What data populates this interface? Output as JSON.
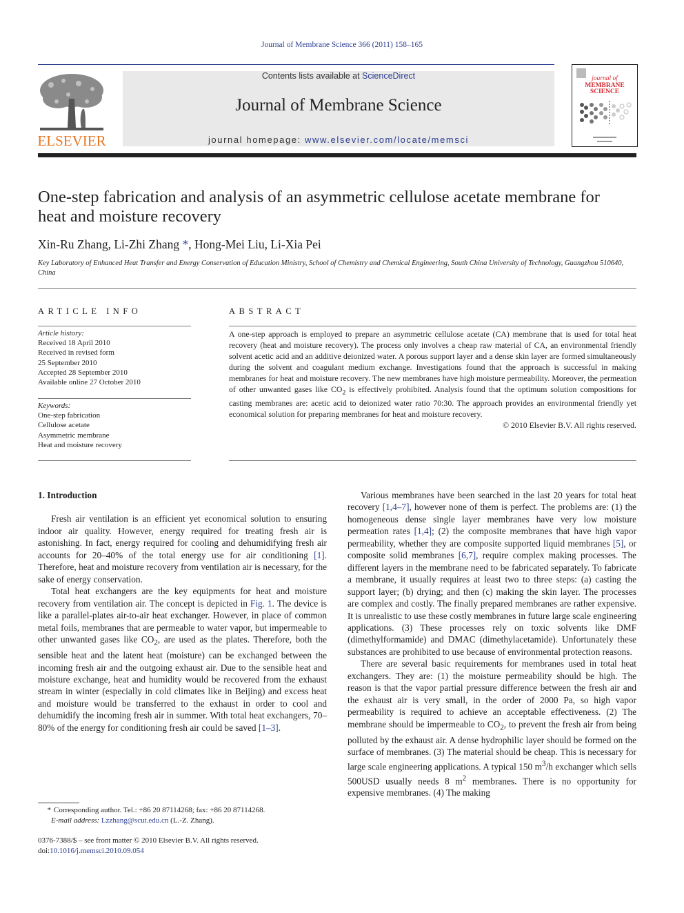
{
  "header": {
    "running_head": "Journal of Membrane Science 366 (2011) 158–165",
    "contents_prefix": "Contents lists available at ",
    "contents_link": "ScienceDirect",
    "journal_name": "Journal of Membrane Science",
    "homepage_prefix": "journal homepage: ",
    "homepage_link": "www.elsevier.com/locate/memsci",
    "publisher_logo": "ELSEVIER",
    "cover_title_line1": "journal of",
    "cover_title_line2": "MEMBRANE",
    "cover_title_line3": "SCIENCE"
  },
  "article": {
    "title": "One-step fabrication and analysis of an asymmetric cellulose acetate membrane for heat and moisture recovery",
    "authors_before": "Xin-Ru Zhang, Li-Zhi Zhang",
    "corresponding_mark": "*",
    "authors_after": ", Hong-Mei Liu, Li-Xia Pei",
    "affiliation": "Key Laboratory of Enhanced Heat Transfer and Energy Conservation of Education Ministry, School of Chemistry and Chemical Engineering, South China University of Technology, Guangzhou 510640, China"
  },
  "article_info": {
    "heading": "ARTICLE INFO",
    "history_label": "Article history:",
    "history": [
      "Received 18 April 2010",
      "Received in revised form",
      "25 September 2010",
      "Accepted 28 September 2010",
      "Available online 27 October 2010"
    ],
    "keywords_label": "Keywords:",
    "keywords": [
      "One-step fabrication",
      "Cellulose acetate",
      "Asymmetric membrane",
      "Heat and moisture recovery"
    ]
  },
  "abstract": {
    "heading": "ABSTRACT",
    "text_part1": "A one-step approach is employed to prepare an asymmetric cellulose acetate (CA) membrane that is used for total heat recovery (heat and moisture recovery). The process only involves a cheap raw material of CA, an environmental friendly solvent acetic acid and an additive deionized water. A porous support layer and a dense skin layer are formed simultaneously during the solvent and coagulant medium exchange. Investigations found that the approach is successful in making membranes for heat and moisture recovery. The new membranes have high moisture permeability. Moreover, the permeation of other unwanted gases like CO",
    "sub": "2",
    "text_part2": " is effectively prohibited. Analysis found that the optimum solution compositions for casting membranes are: acetic acid to deionized water ratio 70:30. The approach provides an environmental friendly yet economical solution for preparing membranes for heat and moisture recovery.",
    "copyright": "© 2010 Elsevier B.V. All rights reserved."
  },
  "body": {
    "section_heading": "1.  Introduction",
    "left_p1_a": "Fresh air ventilation is an efficient yet economical solution to ensuring indoor air quality. However, energy required for treating fresh air is astonishing. In fact, energy required for cooling and dehumidifying fresh air accounts for 20–40% of the total energy use for air conditioning ",
    "left_p1_ref": "[1]",
    "left_p1_b": ". Therefore, heat and moisture recovery from ventilation air is necessary, for the sake of energy conservation.",
    "left_p2_a": "Total heat exchangers are the key equipments for heat and moisture recovery from ventilation air. The concept is depicted in ",
    "left_p2_fig": "Fig. 1",
    "left_p2_b": ". The device is like a parallel-plates air-to-air heat exchanger. However, in place of common metal foils, membranes that are permeable to water vapor, but impermeable to other unwanted gases like CO",
    "left_p2_sub": "2",
    "left_p2_c": ", are used as the plates. Therefore, both the sensible heat and the latent heat (moisture) can be exchanged between the incoming fresh air and the outgoing exhaust air. Due to the sensible heat and moisture exchange, heat and humidity would be recovered from the exhaust stream in winter (especially in cold climates like in Beijing) and excess heat and moisture would be transferred to the exhaust in order to cool and dehumidify the incoming fresh air in summer. With total heat exchangers, 70–80% of the energy for conditioning fresh air could be saved ",
    "left_p2_ref": "[1–3]",
    "left_p2_d": ".",
    "right_p1_a": "Various membranes have been searched in the last 20 years for total heat recovery ",
    "right_p1_ref1": "[1,4–7]",
    "right_p1_b": ", however none of them is perfect. The problems are: (1) the homogeneous dense single layer membranes have very low moisture permeation rates ",
    "right_p1_ref2": "[1,4]",
    "right_p1_c": "; (2) the composite membranes that have high vapor permeability, whether they are composite supported liquid membranes ",
    "right_p1_ref3": "[5]",
    "right_p1_d": ", or composite solid membranes ",
    "right_p1_ref4": "[6,7]",
    "right_p1_e": ", require complex making processes. The different layers in the membrane need to be fabricated separately. To fabricate a membrane, it usually requires at least two to three steps: (a) casting the support layer; (b) drying; and then (c) making the skin layer. The processes are complex and costly. The finally prepared membranes are rather expensive. It is unrealistic to use these costly membranes in future large scale engineering applications. (3) These processes rely on toxic solvents like DMF (dimethylformamide) and DMAC (dimethylacetamide). Unfortunately these substances are prohibited to use because of environmental protection reasons.",
    "right_p2_a": "There are several basic requirements for membranes used in total heat exchangers. They are: (1) the moisture permeability should be high. The reason is that the vapor partial pressure difference between the fresh air and the exhaust air is very small, in the order of 2000 Pa, so high vapor permeability is required to achieve an acceptable effectiveness. (2) The membrane should be impermeable to CO",
    "right_p2_sub": "2",
    "right_p2_b": ", to prevent the fresh air from being polluted by the exhaust air. A dense hydrophilic layer should be formed on the surface of membranes. (3) The material should be cheap. This is necessary for large scale engineering applications. A typical 150 m",
    "right_p2_sup1": "3",
    "right_p2_c": "/h exchanger which sells 500USD usually needs 8 m",
    "right_p2_sup2": "2",
    "right_p2_d": " membranes. There is no opportunity for expensive membranes. (4) The making"
  },
  "footer": {
    "fn_mark": "*",
    "fn_text": "Corresponding author. Tel.: +86 20 87114268; fax: +86 20 87114268.",
    "email_label": "E-mail address: ",
    "email": "Lzzhang@scut.edu.cn",
    "email_suffix": " (L.-Z. Zhang).",
    "front_matter": "0376-7388/$ – see front matter © 2010 Elsevier B.V. All rights reserved.",
    "doi_prefix": "doi:",
    "doi": "10.1016/j.memsci.2010.09.054"
  }
}
